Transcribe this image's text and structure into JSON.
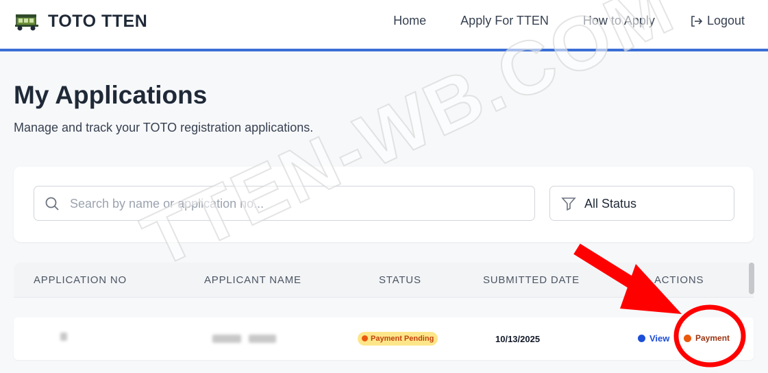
{
  "header": {
    "brand_name": "TOTO TTEN",
    "logo_icon": "auto-rickshaw-icon",
    "nav": [
      {
        "label": "Home"
      },
      {
        "label": "Apply For TTEN"
      },
      {
        "label": "How to Apply"
      },
      {
        "label": "Logout",
        "icon": "logout-icon"
      }
    ],
    "accent_color": "#3b6fd6"
  },
  "page": {
    "title": "My Applications",
    "subtitle": "Manage and track your TOTO registration applications."
  },
  "filters": {
    "search_placeholder": "Search by name or application no...",
    "search_value": "",
    "status_selected": "All Status"
  },
  "table": {
    "columns": [
      "APPLICATION NO",
      "APPLICANT NAME",
      "STATUS",
      "SUBMITTED DATE",
      "ACTIONS"
    ],
    "rows": [
      {
        "application_no": "",
        "applicant_name": "",
        "status": "Payment Pending",
        "status_color": "#fde68a",
        "submitted_date": "10/13/2025",
        "actions": [
          "View",
          "Payment"
        ]
      }
    ]
  },
  "watermark": "TTEN-WB.COM",
  "annotation": {
    "arrow_color": "#ff0000",
    "circle_color": "#ff0000"
  }
}
